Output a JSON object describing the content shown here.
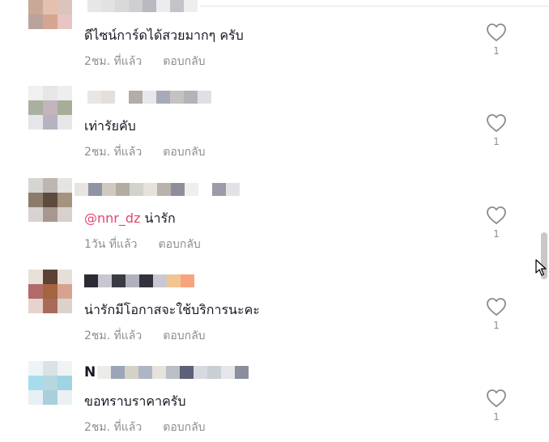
{
  "comments": [
    {
      "text": "ดีไซน์การ์ดได้สวยมากๆ ครับ",
      "mention": "",
      "name_prefix": "",
      "time": "2ชม. ที่แล้ว",
      "reply": "ตอบกลับ",
      "likes": "1",
      "avatar": [
        "#c9a898",
        "#e4c0b0",
        "#dcc3bc",
        "#b9a39b",
        "#d6a592",
        "#e6c5c2",
        "#ffffff",
        "#ffffff",
        "#ffffff"
      ],
      "name_blocks": [
        "#e7e7e9",
        "#e2e2e3",
        "#d9d9db",
        "#cfcfd2",
        "#b9b9c0",
        "#ececee",
        "#c4c4c8",
        "#eeeeef"
      ]
    },
    {
      "text": "เท่ารัยคับ",
      "mention": "",
      "name_prefix": "",
      "time": "2ชม. ที่แล้ว",
      "reply": "ตอบกลับ",
      "likes": "1",
      "avatar": [
        "#f1efef",
        "#e6e6e6",
        "#eeeef0",
        "#a8b0a0",
        "#c3b5bd",
        "#a7ae98",
        "#e6e5e9",
        "#b7b2c0",
        "#e7e7ea"
      ],
      "name_blocks": [
        "#e9e7e4",
        "#e4dfd8",
        "#ffffff",
        "#b4aca6",
        "#e7e8ec",
        "#a7aab8",
        "#c6c2c2",
        "#b4b3b8",
        "#dfe0e6"
      ]
    },
    {
      "text": "น่ารัก",
      "mention": "@nnr_dz",
      "name_prefix": "",
      "time": "1วัน ที่แล้ว",
      "reply": "ตอบกลับ",
      "likes": "1",
      "avatar": [
        "#d7d5d2",
        "#bdb6b0",
        "#e6e4e2",
        "#8c7b6b",
        "#5d4b40",
        "#a4947e",
        "#d8d3d0",
        "#a89790",
        "#d7d0cc"
      ],
      "name_blocks": [
        "#e6e5e1",
        "#8f93a5",
        "#cfc9c2",
        "#b3ad9f",
        "#d3d3cd",
        "#e5e2dc",
        "#b9b1ab",
        "#8e8e9b",
        "#f0efed",
        "#ffffff",
        "#9b9ba9",
        "#e2e2e5"
      ]
    },
    {
      "text": "น่ารักมีโอกาสจะใช้บริการนะคะ",
      "mention": "",
      "name_prefix": "",
      "time": "2ชม. ที่แล้ว",
      "reply": "ตอบกลับ",
      "likes": "1",
      "avatar": [
        "#e8e0da",
        "#5c4135",
        "#e7ded8",
        "#b36a6a",
        "#a3643f",
        "#d7a390",
        "#e7d3cd",
        "#a86a5a",
        "#dcd2cc"
      ],
      "name_blocks": [
        "#2b2b33",
        "#c7c6d1",
        "#3a3a45",
        "#b1b1bd",
        "#32323c",
        "#c9c8d2",
        "#f2c590",
        "#f7a47e"
      ]
    },
    {
      "text": "ขอทราบราคาครับ",
      "mention": "",
      "name_prefix": "N",
      "time": "2ชม. ที่แล้ว",
      "reply": "ตอบกลับ",
      "likes": "1",
      "avatar": [
        "#edf4f7",
        "#d9e2e4",
        "#f0f3f4",
        "#a7dcec",
        "#b6d7e0",
        "#9fd4e3",
        "#e7f0f3",
        "#a9cfdd",
        "#eaf1f3"
      ],
      "name_blocks": [
        "#ecebe8",
        "#9aa6b8",
        "#d4d1c5",
        "#aeb6c6",
        "#e6e3dc",
        "#b9bfc4",
        "#5c6078",
        "#d6d9e0",
        "#c9cfd4",
        "#e6e6ea",
        "#8a8e9f"
      ]
    }
  ],
  "colors": {
    "accent_mention": "#e5446d",
    "meta": "rgba(22,24,35,0.5)"
  }
}
